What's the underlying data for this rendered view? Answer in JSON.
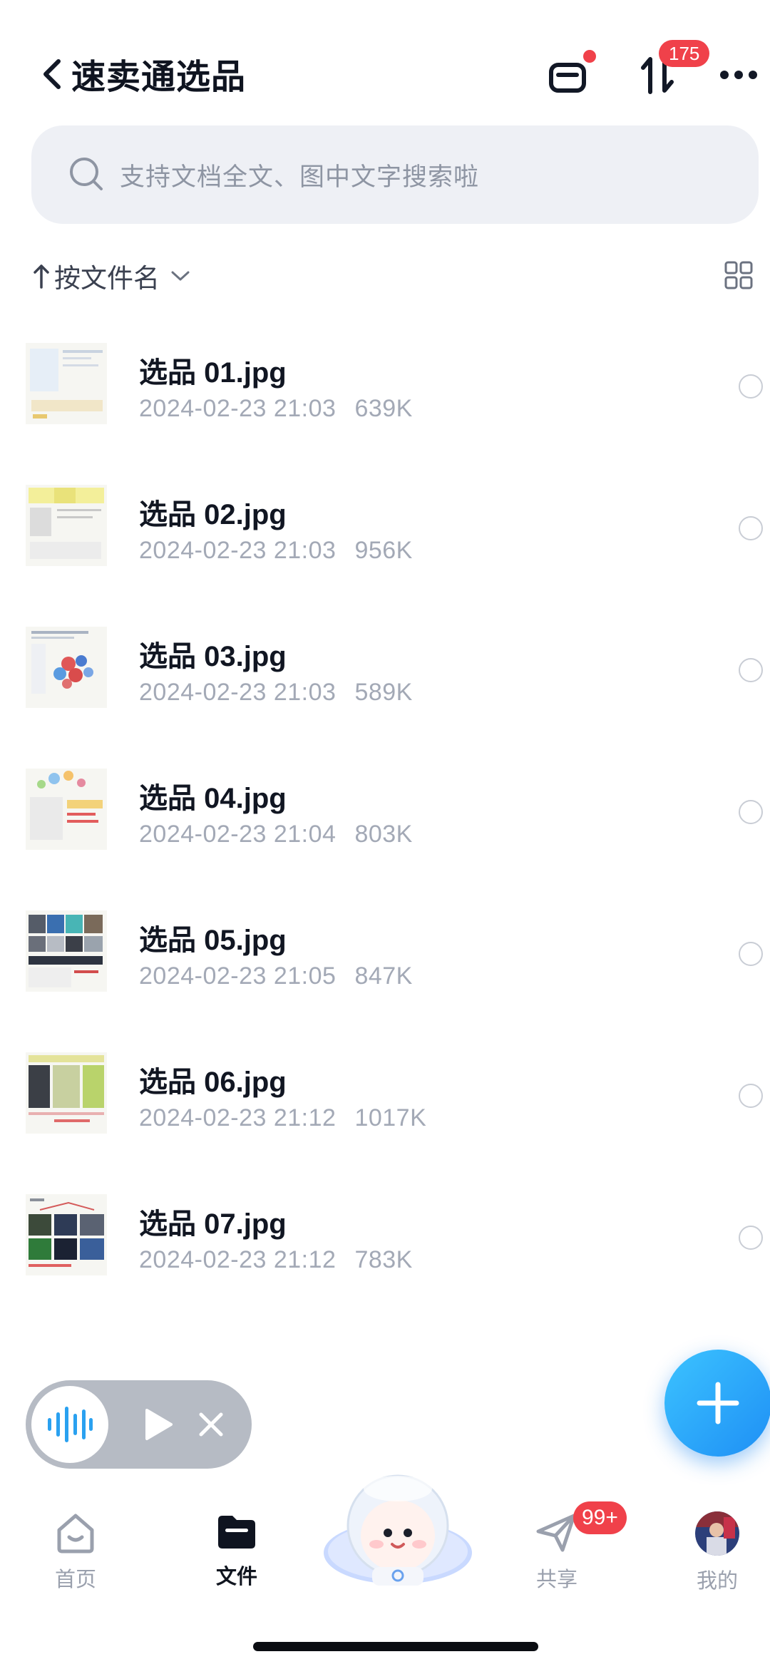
{
  "header": {
    "title": "速卖通选品",
    "transfer_badge": "175"
  },
  "search": {
    "placeholder": "支持文档全文、图中文字搜索啦"
  },
  "sort": {
    "label": "按文件名"
  },
  "files": [
    {
      "name": "选品 01.jpg",
      "date": "2024-02-23 21:03",
      "size": "639K"
    },
    {
      "name": "选品 02.jpg",
      "date": "2024-02-23 21:03",
      "size": "956K"
    },
    {
      "name": "选品 03.jpg",
      "date": "2024-02-23 21:03",
      "size": "589K"
    },
    {
      "name": "选品 04.jpg",
      "date": "2024-02-23 21:04",
      "size": "803K"
    },
    {
      "name": "选品 05.jpg",
      "date": "2024-02-23 21:05",
      "size": "847K"
    },
    {
      "name": "选品 06.jpg",
      "date": "2024-02-23 21:12",
      "size": "1017K"
    },
    {
      "name": "选品 07.jpg",
      "date": "2024-02-23 21:12",
      "size": "783K"
    }
  ],
  "nav": {
    "home": "首页",
    "files": "文件",
    "share": "共享",
    "share_badge": "99+",
    "mine": "我的"
  },
  "colors": {
    "accent": "#1e8ff5",
    "badge": "#f0414a",
    "search_bg": "#eef0f5"
  }
}
